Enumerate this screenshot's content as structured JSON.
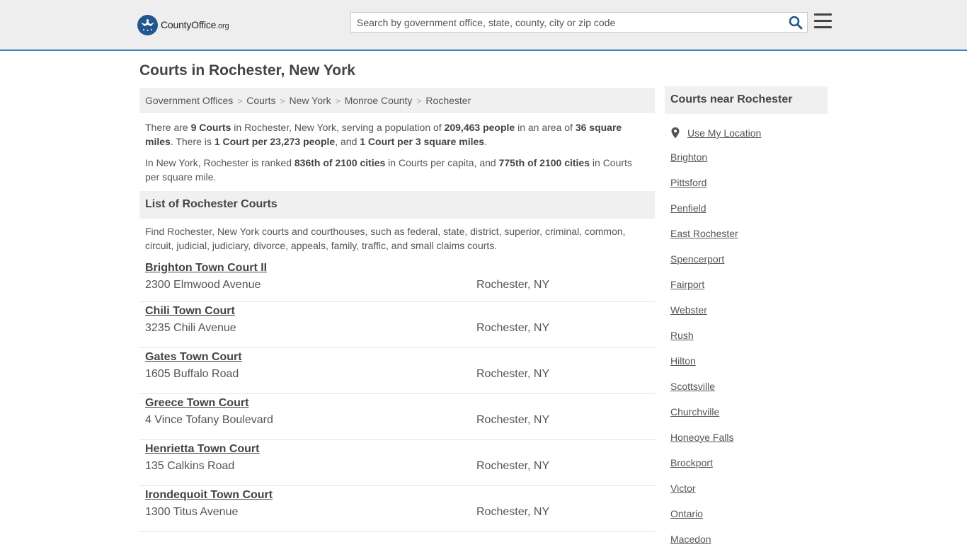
{
  "header": {
    "logo_text_main": "CountyOffice",
    "logo_text_suffix": ".org",
    "search_placeholder": "Search by government office, state, county, city or zip code"
  },
  "page_title": "Courts in Rochester, New York",
  "breadcrumb": [
    "Government Offices",
    "Courts",
    "New York",
    "Monroe County",
    "Rochester"
  ],
  "stats": {
    "p1": {
      "t1": "There are ",
      "count": "9 Courts",
      "t2": " in Rochester, New York, serving a population of ",
      "population": "209,463 people",
      "t3": " in an area of ",
      "area": "36 square miles",
      "t4": ". There is ",
      "per_capita": "1 Court per 23,273 people",
      "t5": ", and ",
      "per_area": "1 Court per 3 square miles",
      "t6": "."
    },
    "p2": {
      "t1": "In New York, Rochester is ranked ",
      "rank_capita": "836th of 2100 cities",
      "t2": " in Courts per capita, and ",
      "rank_area": "775th of 2100 cities",
      "t3": " in Courts per square mile."
    }
  },
  "list": {
    "title": "List of Rochester Courts",
    "description": "Find Rochester, New York courts and courthouses, such as federal, state, district, superior, criminal, common, circuit, judicial, judiciary, divorce, appeals, family, traffic, and small claims courts.",
    "courts": [
      {
        "name": "Brighton Town Court II",
        "address": "2300 Elmwood Avenue",
        "city": "Rochester, NY"
      },
      {
        "name": "Chili Town Court",
        "address": "3235 Chili Avenue",
        "city": "Rochester, NY"
      },
      {
        "name": "Gates Town Court",
        "address": "1605 Buffalo Road",
        "city": "Rochester, NY"
      },
      {
        "name": "Greece Town Court",
        "address": "4 Vince Tofany Boulevard",
        "city": "Rochester, NY"
      },
      {
        "name": "Henrietta Town Court",
        "address": "135 Calkins Road",
        "city": "Rochester, NY"
      },
      {
        "name": "Irondequoit Town Court",
        "address": "1300 Titus Avenue",
        "city": "Rochester, NY"
      }
    ]
  },
  "sidebar": {
    "title": "Courts near Rochester",
    "use_location": "Use My Location",
    "nearby": [
      "Brighton",
      "Pittsford",
      "Penfield",
      "East Rochester",
      "Spencerport",
      "Fairport",
      "Webster",
      "Rush",
      "Hilton",
      "Scottsville",
      "Churchville",
      "Honeoye Falls",
      "Brockport",
      "Victor",
      "Ontario",
      "Macedon"
    ]
  },
  "colors": {
    "header_bg": "#eeeeee",
    "header_border": "#3a7fc1",
    "logo_blue": "#21578f",
    "search_icon": "#21578f",
    "panel_bg": "#f0f0f0"
  },
  "icons": {
    "logo": "eagle-seal-icon",
    "search": "search-icon",
    "menu": "hamburger-menu-icon",
    "location": "map-pin-icon"
  }
}
